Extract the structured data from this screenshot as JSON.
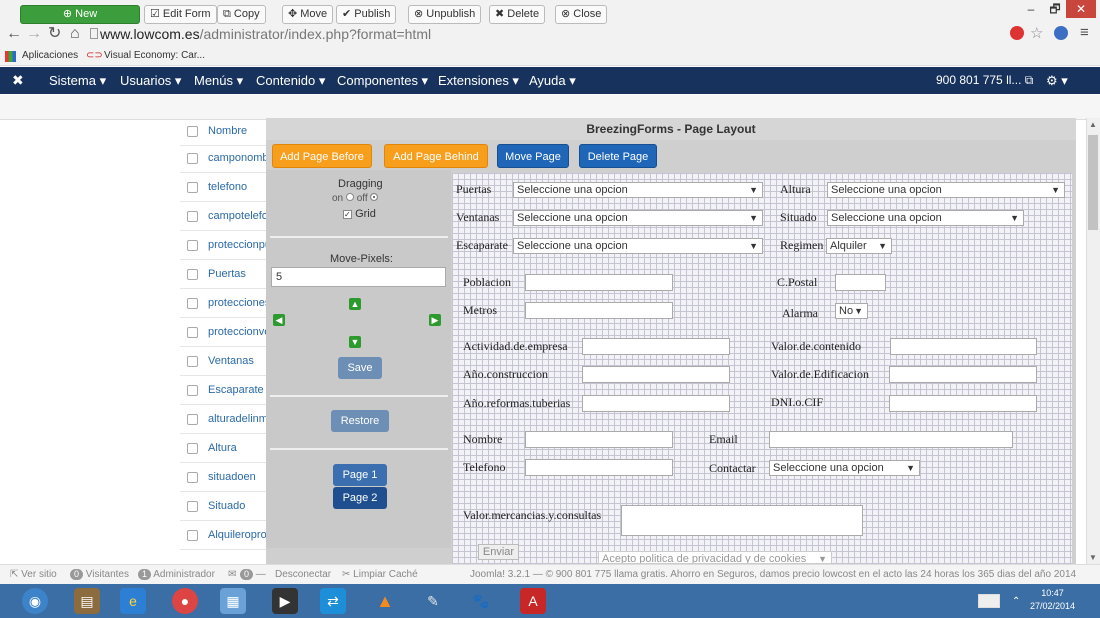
{
  "window": {
    "minimize": "–",
    "maximize": "🗗",
    "close": "✕"
  },
  "browser": {
    "url_host": "www.lowcom.es",
    "url_path": "/administrator/index.php?format=html",
    "bookmarks": [
      {
        "label": "Aplicaciones"
      },
      {
        "label": "Visual Economy: Car..."
      }
    ]
  },
  "topnav": {
    "logo": "✖",
    "items": [
      {
        "label": "Sistema ▾"
      },
      {
        "label": "Usuarios ▾"
      },
      {
        "label": "Menús ▾"
      },
      {
        "label": "Contenido ▾"
      },
      {
        "label": "Componentes ▾"
      },
      {
        "label": "Extensiones ▾"
      },
      {
        "label": "Ayuda ▾"
      }
    ],
    "phone": "900 801 775 ll... ⧉",
    "settings": "⚙ ▾"
  },
  "toolbar": {
    "new": "⊕ New",
    "edit": "☑ Edit Form",
    "copy": "⧉ Copy",
    "move": "✥ Move",
    "publish": "✔ Publish",
    "unpublish": "⊗ Unpublish",
    "delete": "✖ Delete",
    "close": "⊗ Close"
  },
  "list_rows": [
    "Nombre",
    "camponomb",
    "telefono",
    "campotelefo",
    "proteccionpu",
    "Puertas",
    "protecciones",
    "proteccionve",
    "Ventanas",
    "Escaparate",
    "alturadelinm",
    "Altura",
    "situadoen",
    "Situado",
    "Alquileropro"
  ],
  "modal": {
    "title": "BreezingForms - Page Layout",
    "add_before": "Add Page Before",
    "add_behind": "Add Page Behind",
    "move_page": "Move Page",
    "delete_page": "Delete Page",
    "dragging": "Dragging",
    "on": "on",
    "off": "off",
    "grid": "Grid",
    "move_pixels": "Move-Pixels:",
    "move_pixels_value": "5",
    "save": "Save",
    "restore": "Restore",
    "page1": "Page 1",
    "page2": "Page 2"
  },
  "form": {
    "puertas": "Puertas",
    "altura": "Altura",
    "ventanas": "Ventanas",
    "situado": "Situado",
    "escaparate": "Escaparate",
    "regimen": "Regimen",
    "select_placeholder": "Seleccione una opcion",
    "regimen_value": "Alquiler",
    "poblacion": "Poblacion",
    "cpostal": "C.Postal",
    "metros": "Metros",
    "alarma": "Alarma",
    "alarma_value": "No",
    "actividad": "Actividad.de.empresa",
    "valor_contenido": "Valor.de.contenido",
    "anio_construccion": "Año.construccion",
    "valor_edificacion": "Valor.de.Edificacion",
    "anio_reformas": "Año.reformas.tuberias",
    "dni": "DNI.o.CIF",
    "nombre": "Nombre",
    "email": "Email",
    "telefono": "Telefono",
    "contactar": "Contactar",
    "valor_mercancias": "Valor.mercancias.y.consultas",
    "enviar": "Enviar",
    "privacidad": "Acepto politica de privacidad y de cookies"
  },
  "status": {
    "ver_sitio": "⇱ Ver sitio",
    "visitantes_count": "0",
    "visitantes": "Visitantes",
    "admin_count": "1",
    "administrador": "Administrador",
    "msg_count": "0",
    "desconectar": "Desconectar",
    "limpiar": "Limpiar Caché",
    "footer": "Joomla! 3.2.1 — © 900 801 775 llama gratis. Ahorro en Seguros, damos precio lowcost en el acto las 24 horas los 365 dias del año 2014"
  },
  "taskbar": {
    "time": "10:47",
    "date": "27/02/2014"
  }
}
